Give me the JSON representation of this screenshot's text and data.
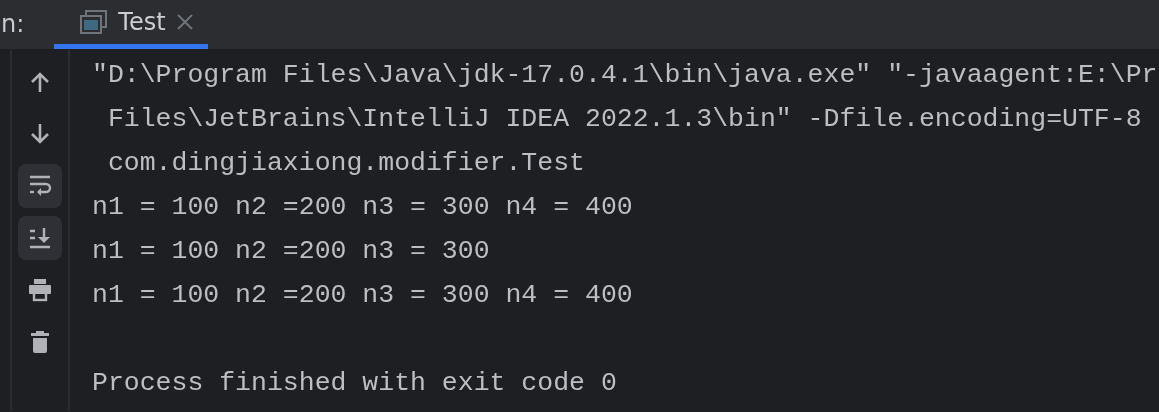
{
  "header": {
    "label": "n:",
    "tabs": [
      {
        "label": "Test",
        "selected": true,
        "closable": true
      }
    ]
  },
  "toolbar": [
    {
      "kind": "up",
      "selected": false
    },
    {
      "kind": "down",
      "selected": false
    },
    {
      "kind": "wrap",
      "selected": true
    },
    {
      "kind": "scroll-end",
      "selected": true
    },
    {
      "kind": "print",
      "selected": false
    },
    {
      "kind": "delete",
      "selected": false
    }
  ],
  "console": {
    "command_lines": [
      "\"D:\\Program Files\\Java\\jdk-17.0.4.1\\bin\\java.exe\" \"-javaagent:E:\\Pr",
      " Files\\JetBrains\\IntelliJ IDEA 2022.1.3\\bin\" -Dfile.encoding=UTF-8",
      " com.dingjiaxiong.modifier.Test"
    ],
    "output_lines": [
      "n1 = 100 n2 =200 n3 = 300 n4 = 400",
      "n1 = 100 n2 =200 n3 = 300",
      "n1 = 100 n2 =200 n3 = 300 n4 = 400"
    ],
    "exit_message": "Process finished with exit code 0"
  }
}
